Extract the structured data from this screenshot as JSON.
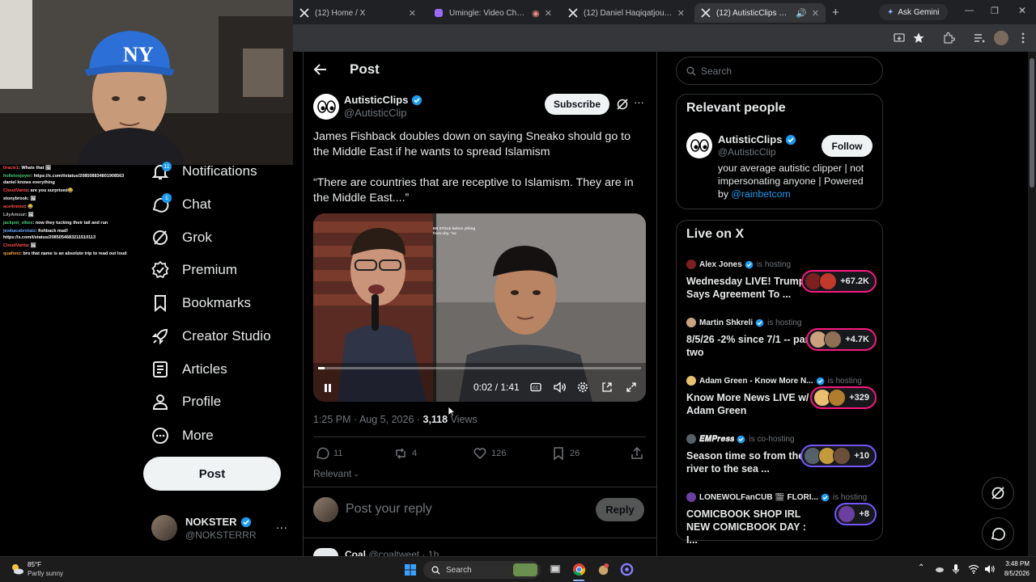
{
  "browser": {
    "tabs": [
      {
        "title": "(12) Home / X",
        "active": false
      },
      {
        "title": "Umingle: Video Chat with",
        "active": false
      },
      {
        "title": "(12) Daniel Haqiqatjou on X",
        "active": false
      },
      {
        "title": "(12) AutisticClips on X: \"J",
        "active": true
      }
    ],
    "gemini_label": "Ask Gemini"
  },
  "chat": [
    {
      "user": "0racle1",
      "msg": ": Whats that 🖼",
      "color": "#ff4d4d"
    },
    {
      "user": "hollelonjoyer",
      "msg": ": https://x.com/i/status/2085088348019085​63 daniel knows everything",
      "color": "#4dd17a"
    },
    {
      "user": "CloudVanta",
      "msg": ": are you surprised😂",
      "color": "#ff4d4d"
    },
    {
      "user": "stonybrook",
      "msg": ": 🖼",
      "color": "#ffffff"
    },
    {
      "user": "ace4nmist",
      "msg": ": 😂",
      "color": "#ff4d4d"
    },
    {
      "user": "LilyAmour",
      "msg": ": 🖼",
      "color": "#bdbdbd"
    },
    {
      "user": "jackpot_vibes",
      "msg": ": now they tucking their tail and run",
      "color": "#4dd17a"
    },
    {
      "user": "jewbacabrotatz",
      "msg": ": fishback mad! https://x.com/i/status/20850546832115101​13",
      "color": "#6aa9ff"
    },
    {
      "user": "CloudVanta",
      "msg": ": 🖼",
      "color": "#ff4d4d"
    },
    {
      "user": "quafonz",
      "msg": ": bro that name is an absolute trip to read out loud",
      "color": "#ff9f40"
    }
  ],
  "nav": {
    "items": [
      {
        "label": "Notifications",
        "icon": "bell-icon",
        "badge": ""
      },
      {
        "label": "Chat",
        "icon": "chat-icon",
        "badge": "1"
      },
      {
        "label": "Grok",
        "icon": "grok-icon",
        "badge": ""
      },
      {
        "label": "Premium",
        "icon": "premium-icon",
        "badge": ""
      },
      {
        "label": "Bookmarks",
        "icon": "bookmark-icon",
        "badge": ""
      },
      {
        "label": "Creator Studio",
        "icon": "rocket-icon",
        "badge": ""
      },
      {
        "label": "Articles",
        "icon": "articles-icon",
        "badge": ""
      },
      {
        "label": "Profile",
        "icon": "person-icon",
        "badge": ""
      },
      {
        "label": "More",
        "icon": "more-circle-icon",
        "badge": ""
      }
    ],
    "post_button": "Post",
    "account": {
      "name": "NOKSTER",
      "handle": "@NOKSTERRR"
    }
  },
  "post": {
    "header_title": "Post",
    "author": {
      "name": "AutisticClips",
      "handle": "@AutisticClip"
    },
    "subscribe_label": "Subscribe",
    "text1": "James Fishback doubles down on saying Sneako should go to the Middle East if he wants to spread Islamism",
    "text2": "“There are countries that are receptive to Islamism. They are in the Middle East....”",
    "video": {
      "time": "0:02 / 1:41",
      "progress": 0.02,
      "overlay_text": "EN STOLE before ything from nity. \"so"
    },
    "meta": {
      "time": "1:25 PM · Aug 5, 2026 · ",
      "views_count": "3,118",
      "views_label": " Views"
    },
    "actions": {
      "replies": "11",
      "reposts": "4",
      "likes": "126",
      "bookmarks": "26"
    },
    "sort_label": "Relevant",
    "reply_placeholder": "Post your reply",
    "reply_button": "Reply",
    "next_post_author": "Coal",
    "next_post_handle": "@coaltweet · 1h"
  },
  "sidebar": {
    "search_placeholder": "Search",
    "relevant_title": "Relevant people",
    "person": {
      "name": "AutisticClips",
      "handle": "@AutisticClip",
      "follow_label": "Follow",
      "bio": "your average autistic clipper | not impersonating anyone | Powered by ",
      "bio_link": "@rainbetcom"
    },
    "live_title": "Live on X",
    "live": [
      {
        "host": "Alex Jones",
        "status": "is hosting",
        "title": "Wednesday LIVE! Trump Says Agreement To ...",
        "count": "+67.2K",
        "ring": "pink"
      },
      {
        "host": "Martin Shkreli",
        "status": "is hosting",
        "title": "8/5/26 -2% since 7/1 -- part two",
        "count": "+4.7K",
        "ring": "pink"
      },
      {
        "host": "Adam Green - Know More N...",
        "status": "is hosting",
        "title": "Know More News LIVE w/ Adam Green",
        "count": "+329",
        "ring": "pink"
      },
      {
        "host": "𝑬𝑴𝑷𝒓𝒆𝒔𝒔",
        "status": "is co-hosting",
        "title": "Season time so from the river to the sea ...",
        "count": "+10",
        "ring": "purple"
      },
      {
        "host": "LONEWOLFanCUB 🎬 FLORI...",
        "status": "is hosting",
        "title": "COMICBOOK SHOP IRL NEW COMICBOOK DAY : I...",
        "count": "+8",
        "ring": "purple"
      }
    ]
  },
  "taskbar": {
    "weather_temp": "85°F",
    "weather_desc": "Partly sunny",
    "search_label": "Search",
    "clock_time": "3:48 PM",
    "clock_date": "8/5/2026"
  },
  "colors": {
    "accent": "#1d9bf0",
    "live_ring": "#f91880",
    "live_ring_alt": "#7856ff"
  }
}
